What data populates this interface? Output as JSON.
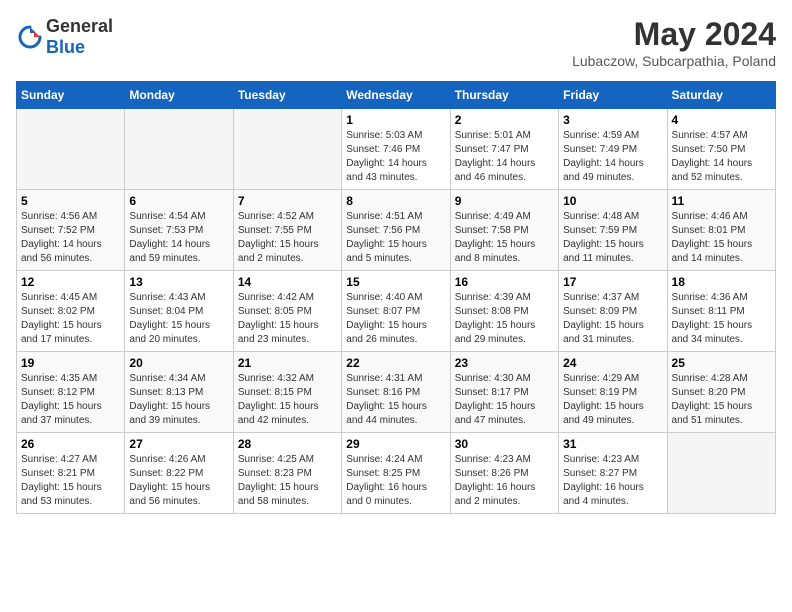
{
  "header": {
    "logo_general": "General",
    "logo_blue": "Blue",
    "month": "May 2024",
    "location": "Lubaczow, Subcarpathia, Poland"
  },
  "weekdays": [
    "Sunday",
    "Monday",
    "Tuesday",
    "Wednesday",
    "Thursday",
    "Friday",
    "Saturday"
  ],
  "weeks": [
    [
      {
        "day": "",
        "sunrise": "",
        "sunset": "",
        "daylight": ""
      },
      {
        "day": "",
        "sunrise": "",
        "sunset": "",
        "daylight": ""
      },
      {
        "day": "",
        "sunrise": "",
        "sunset": "",
        "daylight": ""
      },
      {
        "day": "1",
        "sunrise": "Sunrise: 5:03 AM",
        "sunset": "Sunset: 7:46 PM",
        "daylight": "Daylight: 14 hours and 43 minutes."
      },
      {
        "day": "2",
        "sunrise": "Sunrise: 5:01 AM",
        "sunset": "Sunset: 7:47 PM",
        "daylight": "Daylight: 14 hours and 46 minutes."
      },
      {
        "day": "3",
        "sunrise": "Sunrise: 4:59 AM",
        "sunset": "Sunset: 7:49 PM",
        "daylight": "Daylight: 14 hours and 49 minutes."
      },
      {
        "day": "4",
        "sunrise": "Sunrise: 4:57 AM",
        "sunset": "Sunset: 7:50 PM",
        "daylight": "Daylight: 14 hours and 52 minutes."
      }
    ],
    [
      {
        "day": "5",
        "sunrise": "Sunrise: 4:56 AM",
        "sunset": "Sunset: 7:52 PM",
        "daylight": "Daylight: 14 hours and 56 minutes."
      },
      {
        "day": "6",
        "sunrise": "Sunrise: 4:54 AM",
        "sunset": "Sunset: 7:53 PM",
        "daylight": "Daylight: 14 hours and 59 minutes."
      },
      {
        "day": "7",
        "sunrise": "Sunrise: 4:52 AM",
        "sunset": "Sunset: 7:55 PM",
        "daylight": "Daylight: 15 hours and 2 minutes."
      },
      {
        "day": "8",
        "sunrise": "Sunrise: 4:51 AM",
        "sunset": "Sunset: 7:56 PM",
        "daylight": "Daylight: 15 hours and 5 minutes."
      },
      {
        "day": "9",
        "sunrise": "Sunrise: 4:49 AM",
        "sunset": "Sunset: 7:58 PM",
        "daylight": "Daylight: 15 hours and 8 minutes."
      },
      {
        "day": "10",
        "sunrise": "Sunrise: 4:48 AM",
        "sunset": "Sunset: 7:59 PM",
        "daylight": "Daylight: 15 hours and 11 minutes."
      },
      {
        "day": "11",
        "sunrise": "Sunrise: 4:46 AM",
        "sunset": "Sunset: 8:01 PM",
        "daylight": "Daylight: 15 hours and 14 minutes."
      }
    ],
    [
      {
        "day": "12",
        "sunrise": "Sunrise: 4:45 AM",
        "sunset": "Sunset: 8:02 PM",
        "daylight": "Daylight: 15 hours and 17 minutes."
      },
      {
        "day": "13",
        "sunrise": "Sunrise: 4:43 AM",
        "sunset": "Sunset: 8:04 PM",
        "daylight": "Daylight: 15 hours and 20 minutes."
      },
      {
        "day": "14",
        "sunrise": "Sunrise: 4:42 AM",
        "sunset": "Sunset: 8:05 PM",
        "daylight": "Daylight: 15 hours and 23 minutes."
      },
      {
        "day": "15",
        "sunrise": "Sunrise: 4:40 AM",
        "sunset": "Sunset: 8:07 PM",
        "daylight": "Daylight: 15 hours and 26 minutes."
      },
      {
        "day": "16",
        "sunrise": "Sunrise: 4:39 AM",
        "sunset": "Sunset: 8:08 PM",
        "daylight": "Daylight: 15 hours and 29 minutes."
      },
      {
        "day": "17",
        "sunrise": "Sunrise: 4:37 AM",
        "sunset": "Sunset: 8:09 PM",
        "daylight": "Daylight: 15 hours and 31 minutes."
      },
      {
        "day": "18",
        "sunrise": "Sunrise: 4:36 AM",
        "sunset": "Sunset: 8:11 PM",
        "daylight": "Daylight: 15 hours and 34 minutes."
      }
    ],
    [
      {
        "day": "19",
        "sunrise": "Sunrise: 4:35 AM",
        "sunset": "Sunset: 8:12 PM",
        "daylight": "Daylight: 15 hours and 37 minutes."
      },
      {
        "day": "20",
        "sunrise": "Sunrise: 4:34 AM",
        "sunset": "Sunset: 8:13 PM",
        "daylight": "Daylight: 15 hours and 39 minutes."
      },
      {
        "day": "21",
        "sunrise": "Sunrise: 4:32 AM",
        "sunset": "Sunset: 8:15 PM",
        "daylight": "Daylight: 15 hours and 42 minutes."
      },
      {
        "day": "22",
        "sunrise": "Sunrise: 4:31 AM",
        "sunset": "Sunset: 8:16 PM",
        "daylight": "Daylight: 15 hours and 44 minutes."
      },
      {
        "day": "23",
        "sunrise": "Sunrise: 4:30 AM",
        "sunset": "Sunset: 8:17 PM",
        "daylight": "Daylight: 15 hours and 47 minutes."
      },
      {
        "day": "24",
        "sunrise": "Sunrise: 4:29 AM",
        "sunset": "Sunset: 8:19 PM",
        "daylight": "Daylight: 15 hours and 49 minutes."
      },
      {
        "day": "25",
        "sunrise": "Sunrise: 4:28 AM",
        "sunset": "Sunset: 8:20 PM",
        "daylight": "Daylight: 15 hours and 51 minutes."
      }
    ],
    [
      {
        "day": "26",
        "sunrise": "Sunrise: 4:27 AM",
        "sunset": "Sunset: 8:21 PM",
        "daylight": "Daylight: 15 hours and 53 minutes."
      },
      {
        "day": "27",
        "sunrise": "Sunrise: 4:26 AM",
        "sunset": "Sunset: 8:22 PM",
        "daylight": "Daylight: 15 hours and 56 minutes."
      },
      {
        "day": "28",
        "sunrise": "Sunrise: 4:25 AM",
        "sunset": "Sunset: 8:23 PM",
        "daylight": "Daylight: 15 hours and 58 minutes."
      },
      {
        "day": "29",
        "sunrise": "Sunrise: 4:24 AM",
        "sunset": "Sunset: 8:25 PM",
        "daylight": "Daylight: 16 hours and 0 minutes."
      },
      {
        "day": "30",
        "sunrise": "Sunrise: 4:23 AM",
        "sunset": "Sunset: 8:26 PM",
        "daylight": "Daylight: 16 hours and 2 minutes."
      },
      {
        "day": "31",
        "sunrise": "Sunrise: 4:23 AM",
        "sunset": "Sunset: 8:27 PM",
        "daylight": "Daylight: 16 hours and 4 minutes."
      },
      {
        "day": "",
        "sunrise": "",
        "sunset": "",
        "daylight": ""
      }
    ]
  ]
}
